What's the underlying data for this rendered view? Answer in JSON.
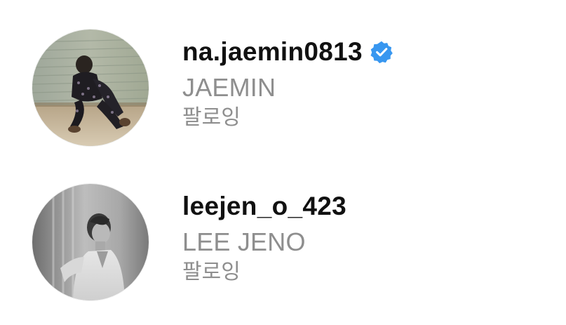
{
  "accounts": [
    {
      "username": "na.jaemin0813",
      "full_name": "JAEMIN",
      "status": "팔로잉",
      "verified": true,
      "avatar_icon": "profile-photo-color"
    },
    {
      "username": "leejen_o_423",
      "full_name": "LEE JENO",
      "status": "팔로잉",
      "verified": false,
      "avatar_icon": "profile-photo-grayscale"
    }
  ],
  "colors": {
    "username": "#111111",
    "secondary_text": "#8e8e8e",
    "verified_badge": "#3897f0",
    "background": "#ffffff"
  }
}
